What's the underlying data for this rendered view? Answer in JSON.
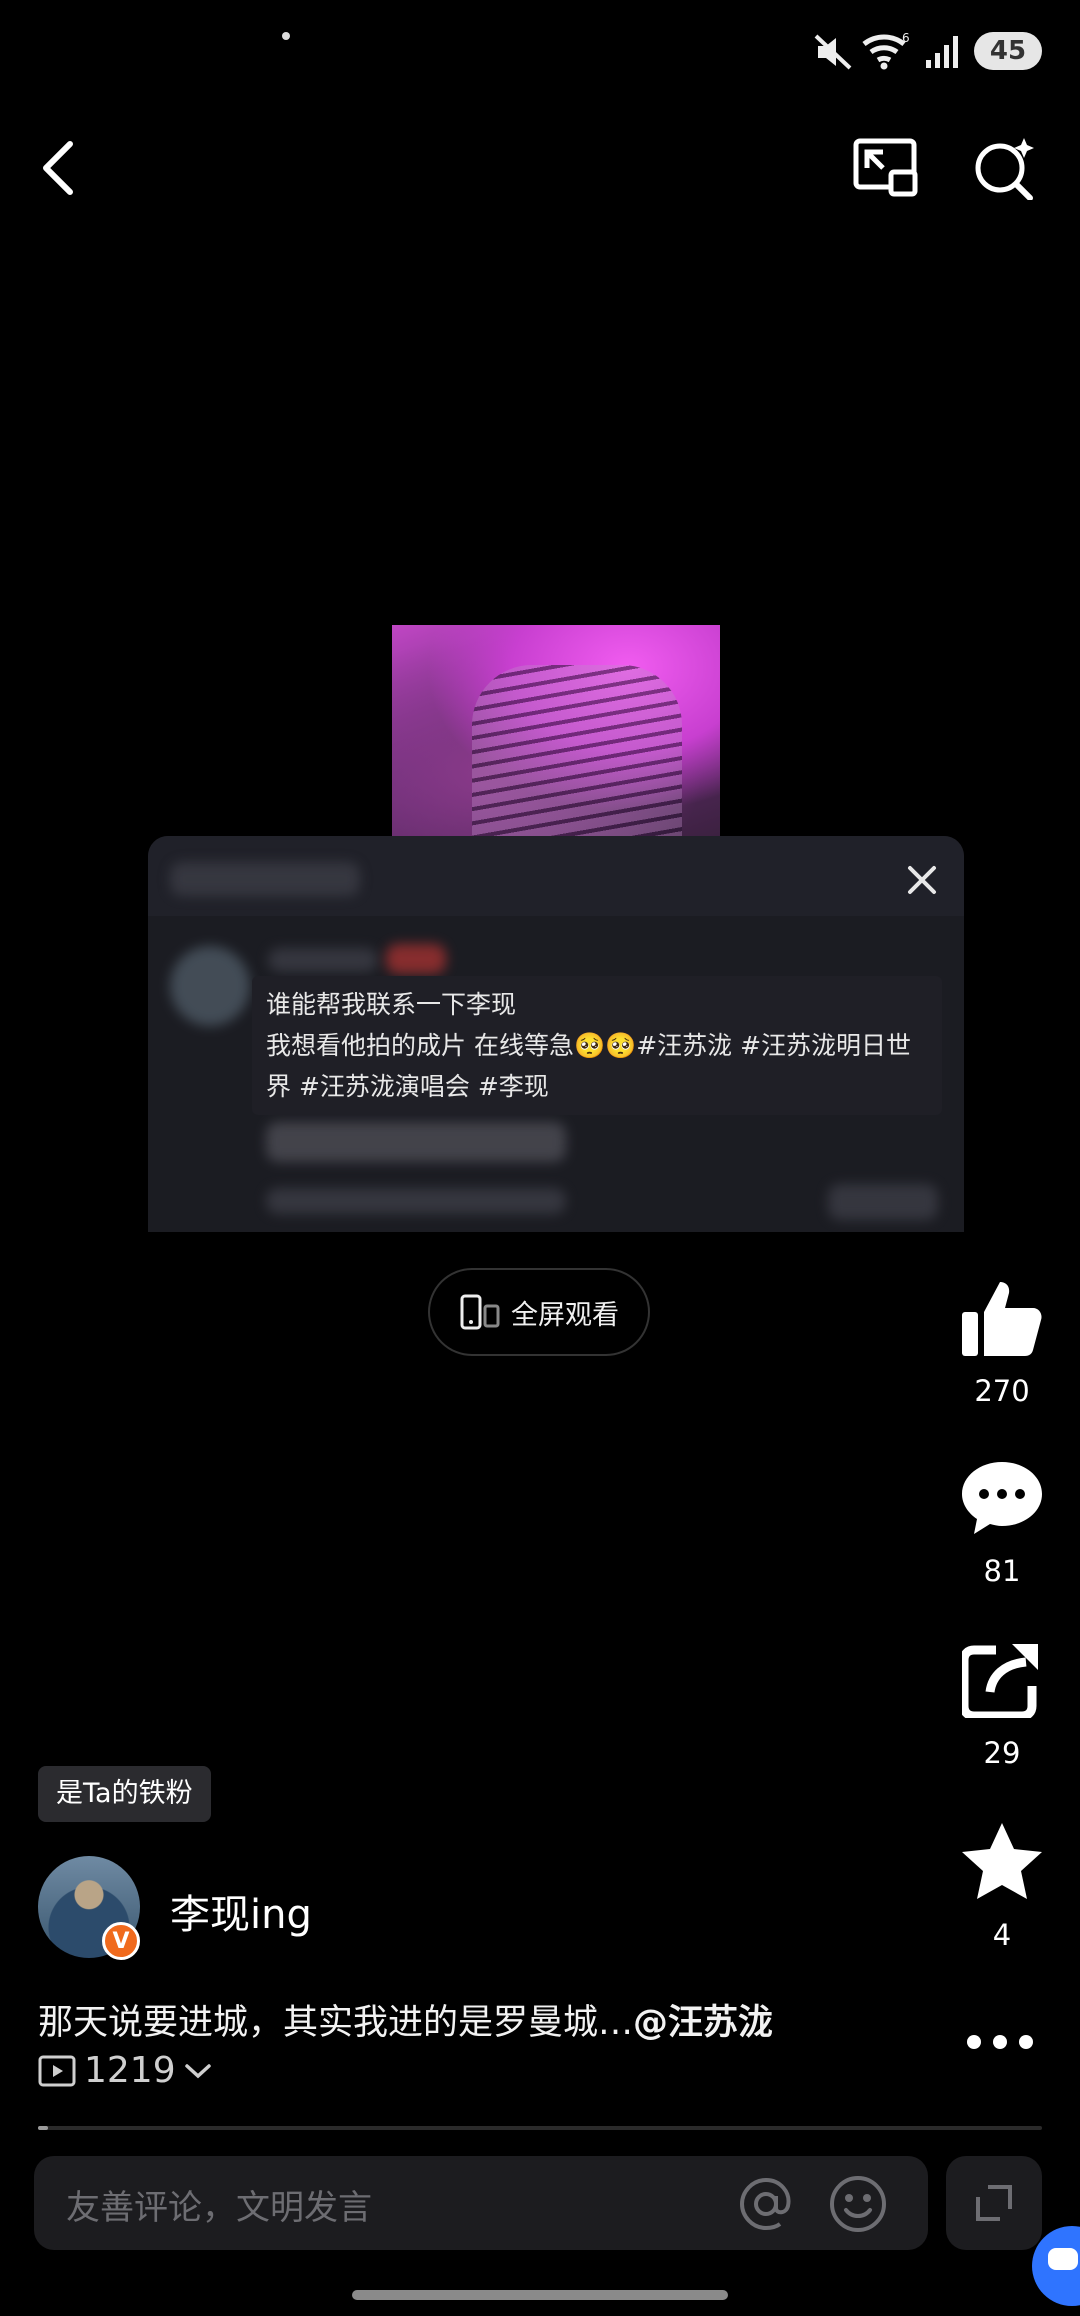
{
  "status_bar": {
    "battery": "45",
    "wifi_badge": "6"
  },
  "overlay": {
    "caption_line1": "谁能帮我联系一下李现",
    "caption_line2": "我想看他拍的成片 在线等急🥺🥺#汪苏泷 #汪苏泷明日世",
    "caption_line3": "界 #汪苏泷演唱会 #李现"
  },
  "fullscreen_label": "全屏观看",
  "actions": {
    "likes": "270",
    "comments": "81",
    "shares": "29",
    "favorites": "4"
  },
  "fan_badge": "是Ta的铁粉",
  "author": {
    "name": "李现ing",
    "verified_mark": "V"
  },
  "description": {
    "text": "那天说要进城，其实我进的是罗曼城…",
    "mention": "@汪苏泷"
  },
  "play_count": "1219",
  "progress_fraction": 0.01,
  "comment_input": {
    "placeholder": "友善评论，文明发言"
  }
}
